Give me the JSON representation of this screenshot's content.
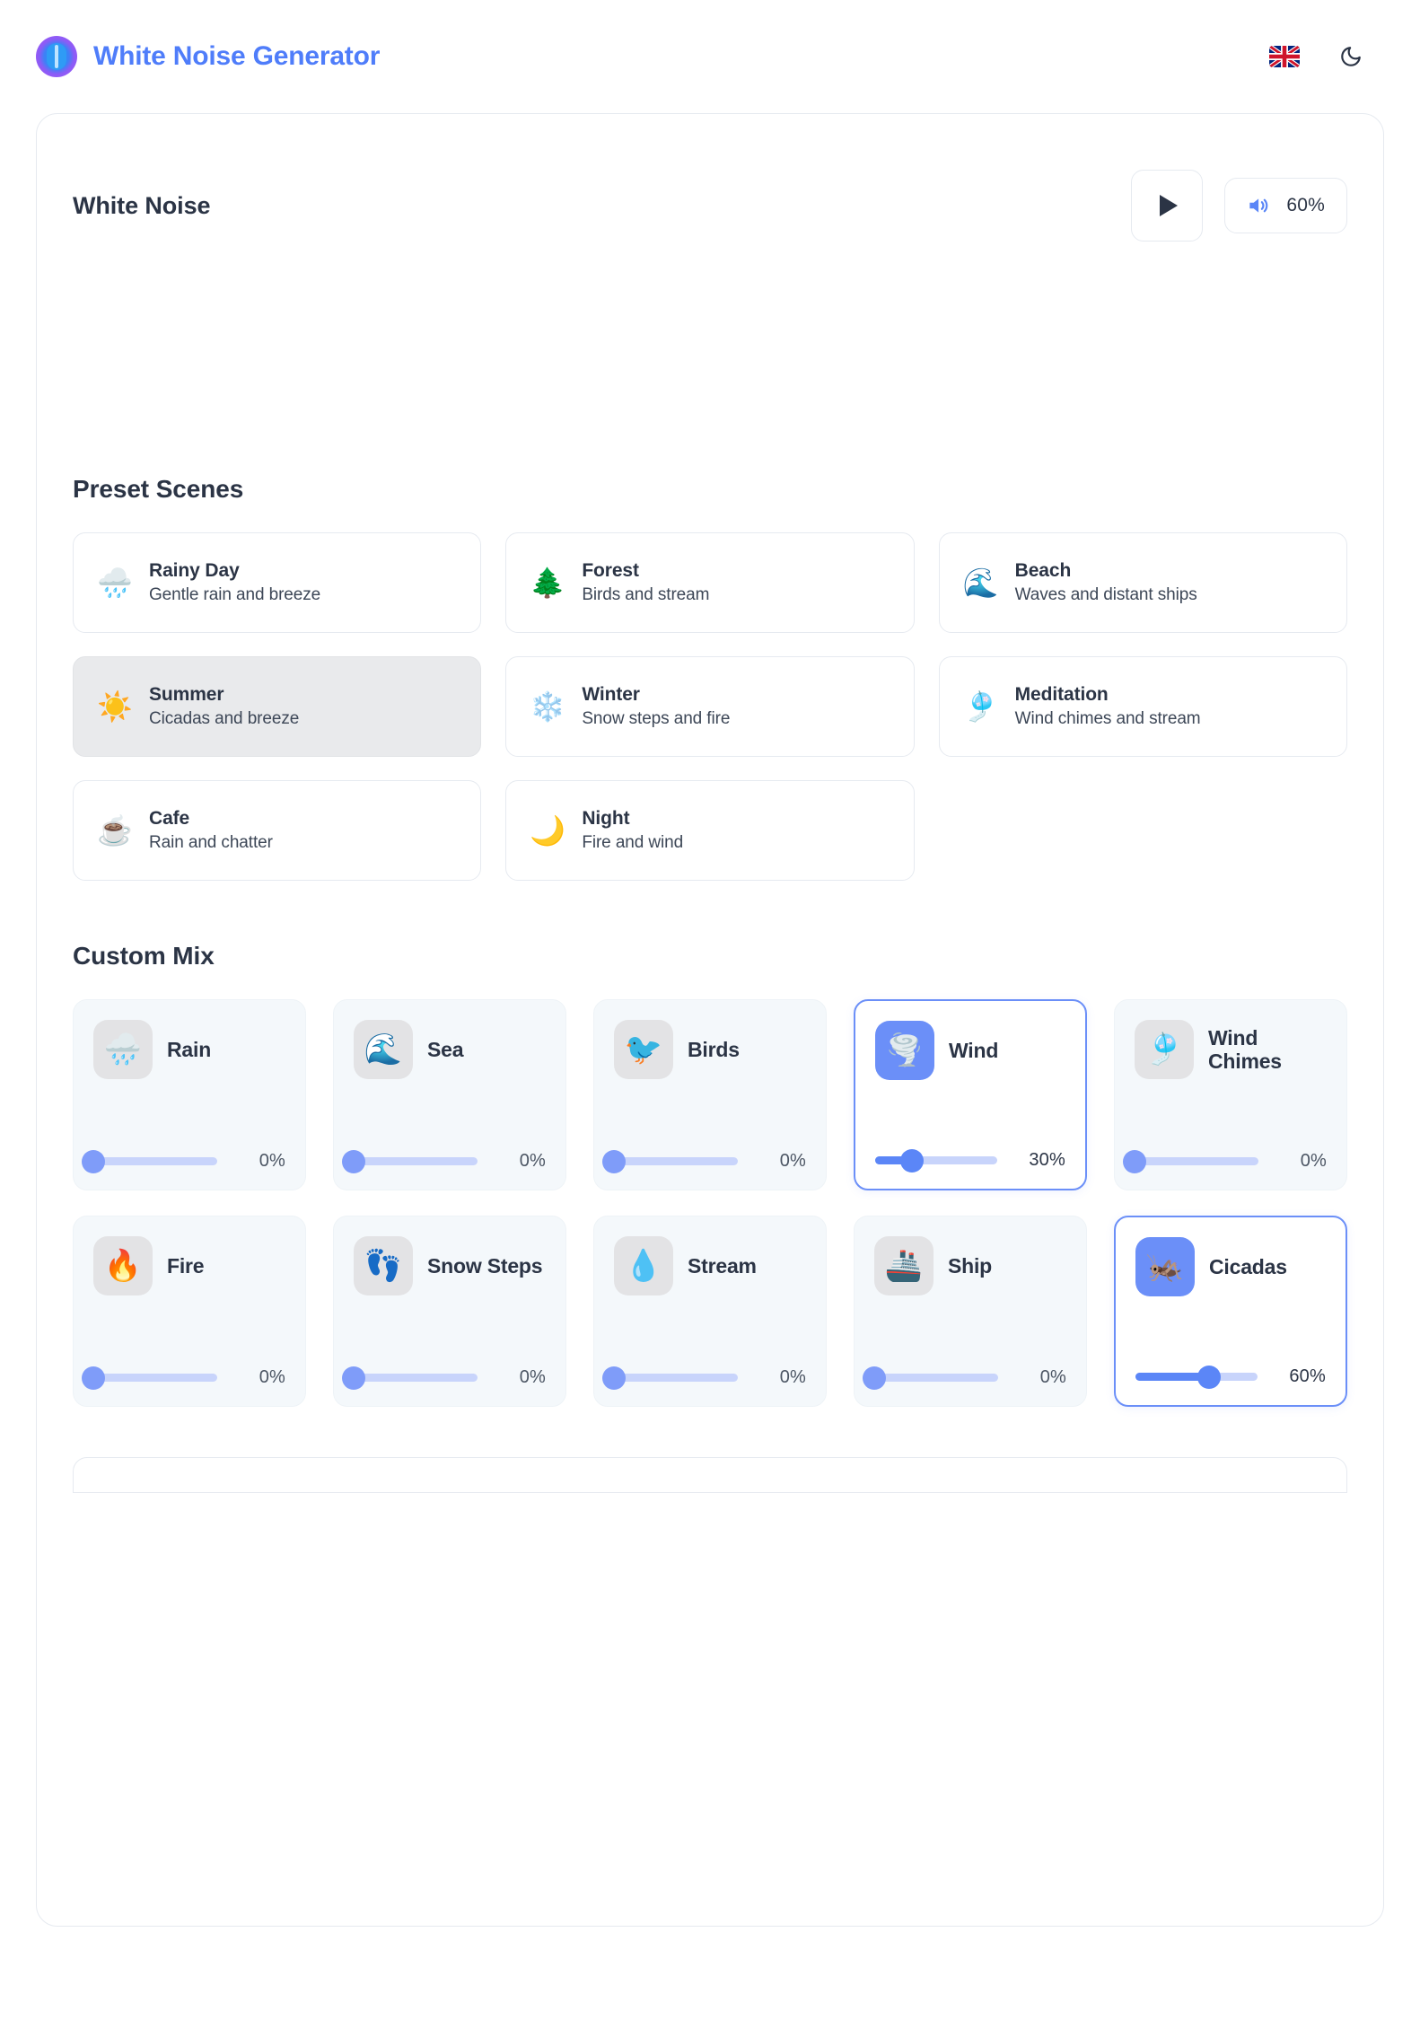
{
  "header": {
    "brand_title": "White Noise Generator",
    "logo_icon": "sound-wave-logo-icon",
    "language_icon": "uk-flag-icon",
    "theme_icon": "moon-icon"
  },
  "player": {
    "title": "White Noise",
    "play_icon": "play-icon",
    "volume_icon": "volume-icon",
    "volume_label": "60%",
    "volume_percent": 60
  },
  "presets": {
    "heading": "Preset Scenes",
    "items": [
      {
        "emoji": "🌧️",
        "icon_name": "rain-cloud-icon",
        "name": "Rainy Day",
        "desc": "Gentle rain and breeze",
        "selected": false
      },
      {
        "emoji": "🌲",
        "icon_name": "evergreen-tree-icon",
        "name": "Forest",
        "desc": "Birds and stream",
        "selected": false
      },
      {
        "emoji": "🌊",
        "icon_name": "ocean-wave-icon",
        "name": "Beach",
        "desc": "Waves and distant ships",
        "selected": false
      },
      {
        "emoji": "☀️",
        "icon_name": "sun-icon",
        "name": "Summer",
        "desc": "Cicadas and breeze",
        "selected": true
      },
      {
        "emoji": "❄️",
        "icon_name": "snowflake-icon",
        "name": "Winter",
        "desc": "Snow steps and fire",
        "selected": false
      },
      {
        "emoji": "🎐",
        "icon_name": "wind-chime-icon",
        "name": "Meditation",
        "desc": "Wind chimes and stream",
        "selected": false
      },
      {
        "emoji": "☕",
        "icon_name": "coffee-cup-icon",
        "name": "Cafe",
        "desc": "Rain and chatter",
        "selected": false
      },
      {
        "emoji": "🌙",
        "icon_name": "crescent-moon-icon",
        "name": "Night",
        "desc": "Fire and wind",
        "selected": false
      }
    ]
  },
  "custom_mix": {
    "heading": "Custom Mix",
    "sounds": [
      {
        "emoji": "🌧️",
        "icon_name": "rain-cloud-icon",
        "label": "Rain",
        "value_label": "0%",
        "value": 0,
        "active": false
      },
      {
        "emoji": "🌊",
        "icon_name": "ocean-wave-icon",
        "label": "Sea",
        "value_label": "0%",
        "value": 0,
        "active": false
      },
      {
        "emoji": "🐦",
        "icon_name": "bird-icon",
        "label": "Birds",
        "value_label": "0%",
        "value": 0,
        "active": false
      },
      {
        "emoji": "🌪️",
        "icon_name": "tornado-icon",
        "label": "Wind",
        "value_label": "30%",
        "value": 30,
        "active": true
      },
      {
        "emoji": "🎐",
        "icon_name": "wind-chime-icon",
        "label": "Wind Chimes",
        "value_label": "0%",
        "value": 0,
        "active": false
      },
      {
        "emoji": "🔥",
        "icon_name": "fire-icon",
        "label": "Fire",
        "value_label": "0%",
        "value": 0,
        "active": false
      },
      {
        "emoji": "👣",
        "icon_name": "footprints-icon",
        "label": "Snow Steps",
        "value_label": "0%",
        "value": 0,
        "active": false
      },
      {
        "emoji": "💧",
        "icon_name": "water-drop-icon",
        "label": "Stream",
        "value_label": "0%",
        "value": 0,
        "active": false
      },
      {
        "emoji": "🚢",
        "icon_name": "ship-icon",
        "label": "Ship",
        "value_label": "0%",
        "value": 0,
        "active": false
      },
      {
        "emoji": "🦗",
        "icon_name": "cricket-icon",
        "label": "Cicadas",
        "value_label": "60%",
        "value": 60,
        "active": true
      }
    ]
  },
  "colors": {
    "accent_blue": "#5b86f7",
    "brand_blue": "#4f7dfa",
    "text_dark": "#2b3445",
    "tile_bg": "#f4f8fb",
    "selected_preset_bg": "#e9eaec"
  }
}
